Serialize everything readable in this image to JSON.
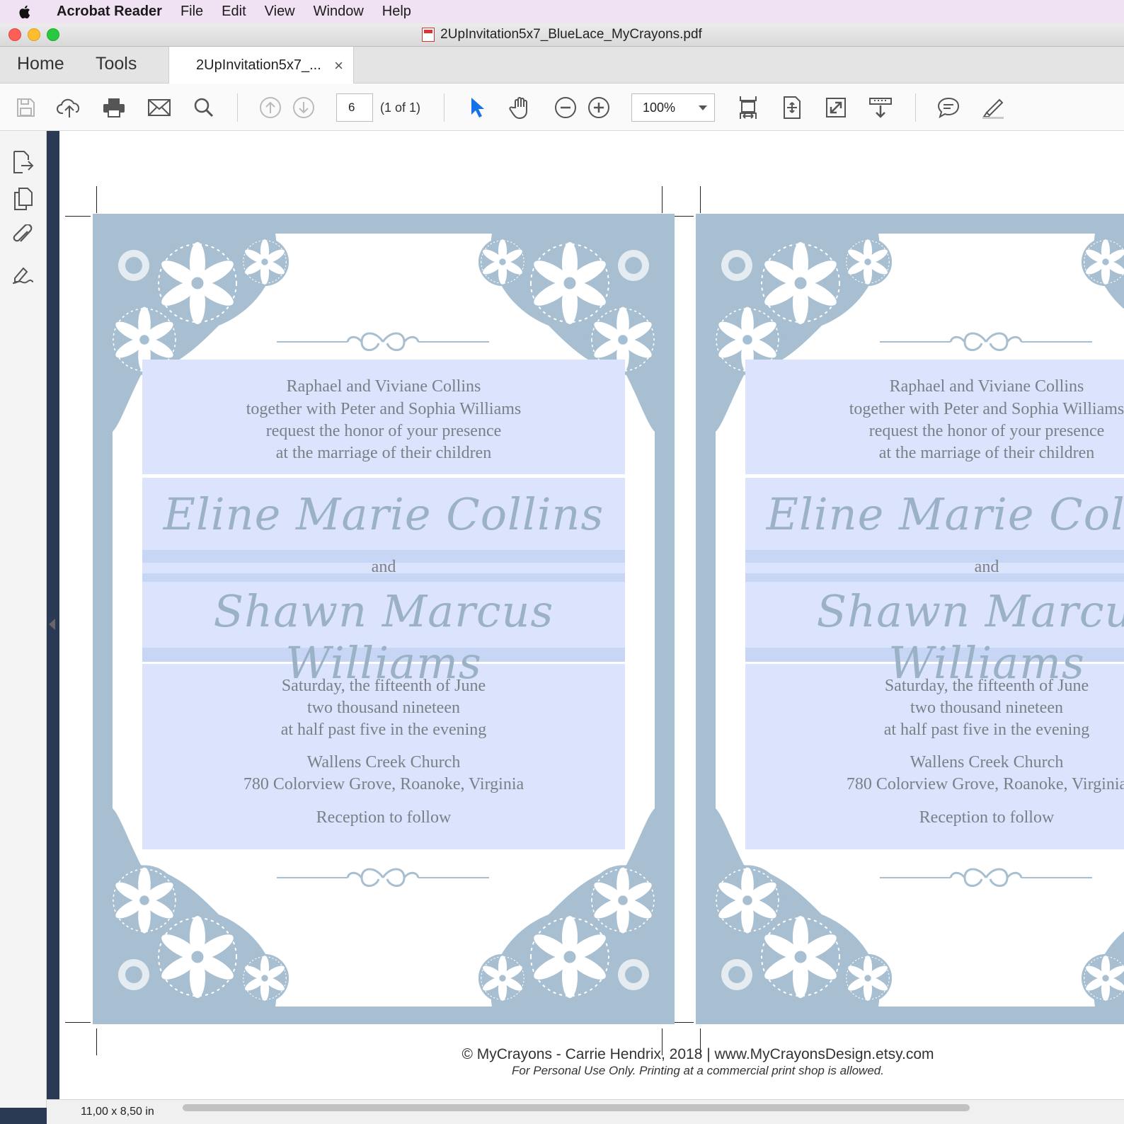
{
  "menubar": {
    "app_name": "Acrobat Reader",
    "items": [
      "File",
      "Edit",
      "View",
      "Window",
      "Help"
    ]
  },
  "window": {
    "title": "2UpInvitation5x7_BlueLace_MyCrayons.pdf",
    "colors": {
      "close": "#fe5f57",
      "minimize": "#febc2e",
      "zoom": "#28c840"
    }
  },
  "tabs": {
    "home": "Home",
    "tools": "Tools",
    "document": "2UpInvitation5x7_...",
    "close_symbol": "×"
  },
  "toolbar": {
    "icons": [
      "save-icon",
      "upload-cloud-icon",
      "print-icon",
      "email-icon",
      "search-icon",
      "page-up-icon",
      "page-down-icon",
      "select-arrow-icon",
      "hand-icon",
      "zoom-out-icon",
      "zoom-in-icon",
      "fit-width-icon",
      "fit-page-icon",
      "fullscreen-icon",
      "scroll-mode-icon",
      "comment-icon",
      "highlight-icon"
    ],
    "page_number": "6",
    "page_count": "(1 of 1)",
    "zoom": "100%",
    "accent": "#1473e6"
  },
  "left_rail": {
    "icons": [
      "export-pdf-icon",
      "page-thumbnails-icon",
      "attachments-icon",
      "fill-sign-icon"
    ]
  },
  "invitation": {
    "colors": {
      "lace": "#a7bfd0",
      "band": "#dbe3fd",
      "text": "#7b8088",
      "script": "#9ab1c6"
    },
    "hosts": [
      "Raphael and Viviane Collins",
      "together with Peter and Sophia Williams",
      "request the honor of your presence",
      "at the marriage of their children"
    ],
    "bride": "Eline Marie Collins",
    "and": "and",
    "groom": "Shawn Marcus Williams",
    "date": [
      "Saturday, the fifteenth of June",
      "two thousand nineteen",
      "at half past five in the evening"
    ],
    "venue": [
      "Wallens Creek Church",
      "780 Colorview Grove, Roanoke, Virginia"
    ],
    "reception": "Reception to follow"
  },
  "footer": {
    "credit": "© MyCrayons - Carrie Hendrix, 2018 | www.MyCrayonsDesign.etsy.com",
    "note": "For Personal Use Only. Printing at a commercial print shop is allowed."
  },
  "status": {
    "page_size": "11,00 x 8,50 in"
  }
}
